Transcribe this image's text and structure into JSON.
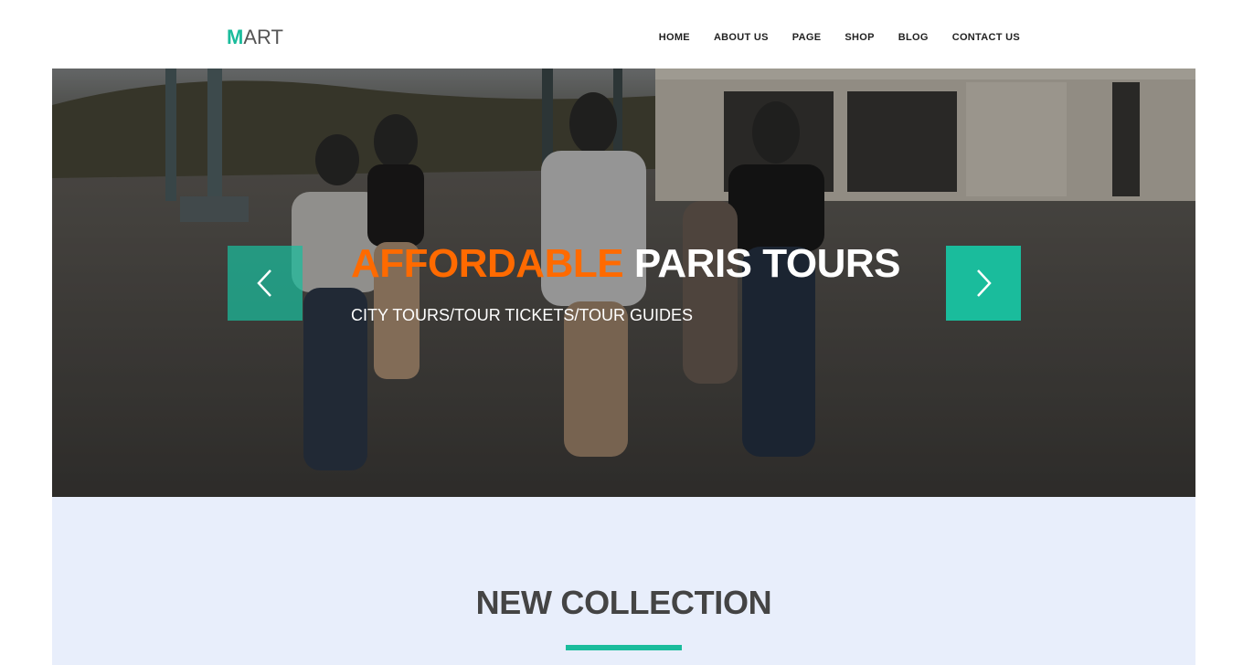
{
  "logo": {
    "accent": "M",
    "rest": "ART"
  },
  "nav": {
    "items": [
      "HOME",
      "ABOUT US",
      "PAGE",
      "SHOP",
      "BLOG",
      "CONTACT US"
    ]
  },
  "hero": {
    "title_accent": "AFFORDABLE",
    "title_rest": "PARIS TOURS",
    "subtitle": "CITY TOURS/TOUR TICKETS/TOUR GUIDES",
    "prev_icon": "chevron-left-icon",
    "next_icon": "chevron-right-icon"
  },
  "collection": {
    "title": "NEW COLLECTION"
  },
  "colors": {
    "accent": "#1abc9c",
    "title_accent": "#ff6a00",
    "section_bg": "#e8eefb"
  }
}
